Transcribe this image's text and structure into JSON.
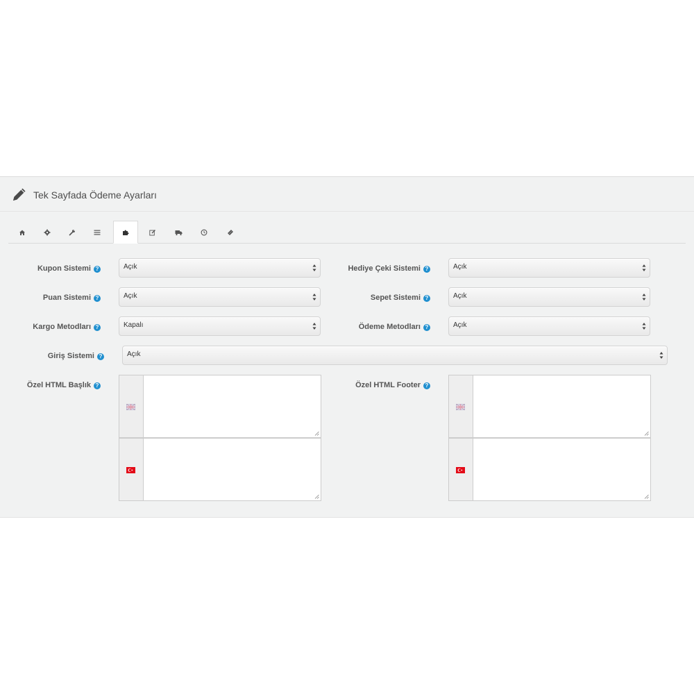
{
  "panel": {
    "title": "Tek Sayfada Ödeme Ayarları",
    "title_icon": "pencil-icon"
  },
  "tabs": [
    {
      "icon": "home-icon",
      "active": false
    },
    {
      "icon": "cog-icon",
      "active": false
    },
    {
      "icon": "wrench-icon",
      "active": false
    },
    {
      "icon": "list-icon",
      "active": false
    },
    {
      "icon": "puzzle-icon",
      "active": true
    },
    {
      "icon": "edit-icon",
      "active": false
    },
    {
      "icon": "truck-icon",
      "active": false
    },
    {
      "icon": "clock-icon",
      "active": false
    },
    {
      "icon": "ticket-icon",
      "active": false
    }
  ],
  "fields": {
    "kupon": {
      "label": "Kupon Sistemi",
      "value": "Açık"
    },
    "hediye": {
      "label": "Hediye Çeki Sistemi",
      "value": "Açık"
    },
    "puan": {
      "label": "Puan Sistemi",
      "value": "Açık"
    },
    "sepet": {
      "label": "Sepet Sistemi",
      "value": "Açık"
    },
    "kargo": {
      "label": "Kargo Metodları",
      "value": "Kapalı"
    },
    "odeme": {
      "label": "Ödeme Metodları",
      "value": "Açık"
    },
    "giris": {
      "label": "Giriş Sistemi",
      "value": "Açık"
    },
    "baslik": {
      "label": "Özel HTML Başlık"
    },
    "footer": {
      "label": "Özel HTML Footer"
    }
  },
  "help_icon": "?",
  "languages": [
    "english-flag-icon",
    "turkish-flag-icon"
  ],
  "colors": {
    "accent": "#1f8fcf",
    "panel_bg": "#f1f2f2"
  }
}
